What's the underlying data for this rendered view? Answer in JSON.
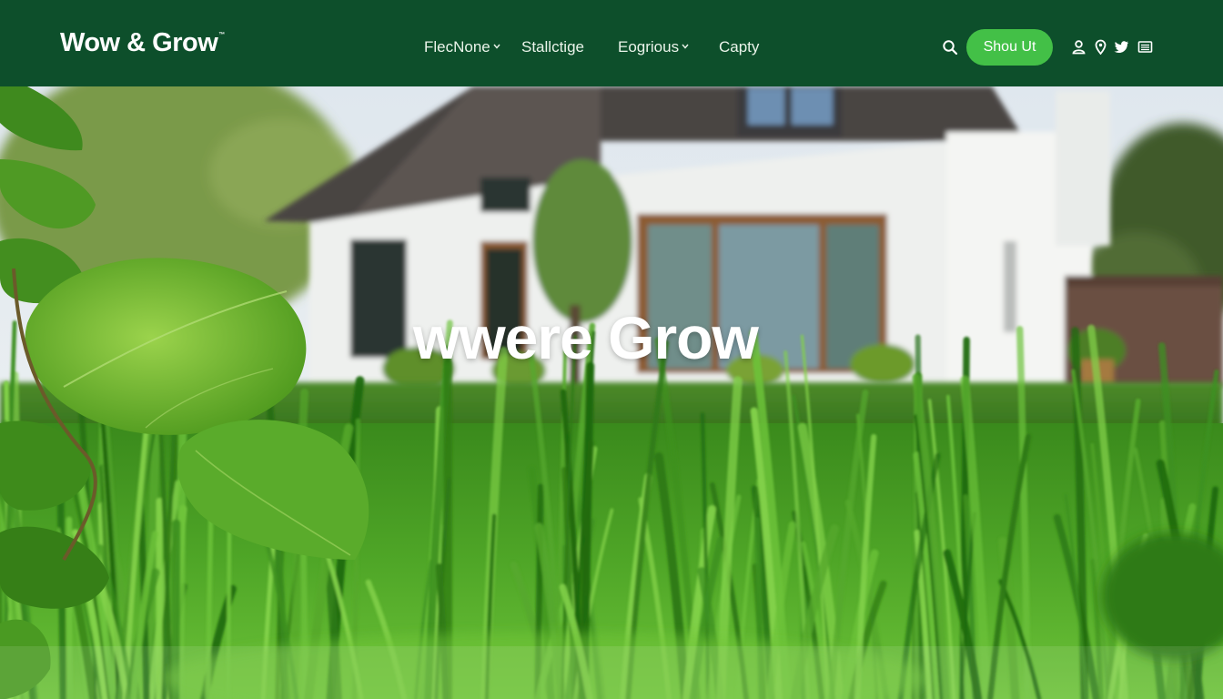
{
  "header": {
    "logo": "Wow & Grow",
    "logo_tm": "™",
    "nav": [
      {
        "label": "FlecNone",
        "has_dropdown": true
      },
      {
        "label": "Stallctige",
        "has_dropdown": false
      },
      {
        "label": "Eogrious",
        "has_dropdown": true
      },
      {
        "label": "Capty",
        "has_dropdown": false
      }
    ],
    "cta_label": "Shou Ut",
    "icons": [
      "search-icon",
      "user-icon",
      "location-pin-icon",
      "twitter-icon",
      "menu-list-icon"
    ]
  },
  "hero": {
    "headline": "wwere Grow"
  },
  "colors": {
    "header_bg": "#0d4f2b",
    "cta_bg": "#43c047",
    "text_light": "#ffffff"
  }
}
